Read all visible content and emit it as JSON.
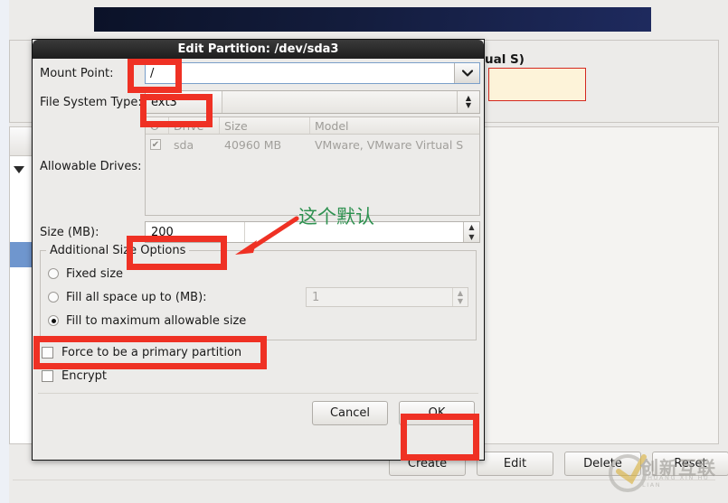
{
  "background": {
    "truncated_label": "ual S)",
    "buttons": [
      "Create",
      "Edit",
      "Delete",
      "Reset"
    ],
    "watermark": {
      "text": "创新互联",
      "subtext": "CHUANG XIN HU LIAN"
    },
    "banner_color": "#131c3c",
    "warn_box_color": "#fdf3d9",
    "warn_border_color": "#d4281f",
    "selection_color": "#6f96ce"
  },
  "dialog": {
    "title": "Edit Partition: /dev/sda3",
    "mount_point": {
      "label": "Mount Point:",
      "value": "/",
      "arrow_icon": "chevron-down-icon"
    },
    "file_system_type": {
      "label": "File System Type:",
      "value": "ext3",
      "spinner_icon": "up-down-spinner-icon"
    },
    "allowable_drives": {
      "label": "Allowable Drives:",
      "columns": [
        "O",
        "Drive",
        "Size",
        "Model"
      ],
      "rows": [
        {
          "checked": "✔",
          "drive": "sda",
          "size": "40960 MB",
          "model": "VMware, VMware Virtual S"
        }
      ]
    },
    "size": {
      "label": "Size (MB):",
      "value": "200"
    },
    "additional_size_options": {
      "legend": "Additional Size Options",
      "options": [
        {
          "label": "Fixed size",
          "selected": false
        },
        {
          "label": "Fill all space up to (MB):",
          "selected": false,
          "value": "1"
        },
        {
          "label": "Fill to maximum allowable size",
          "selected": true
        }
      ]
    },
    "checkboxes": [
      {
        "label": "Force to be a primary partition",
        "checked": false
      },
      {
        "label": "Encrypt",
        "checked": false
      }
    ],
    "buttons": {
      "cancel": "Cancel",
      "ok": "OK"
    }
  },
  "annotations": {
    "note_text": "这个默认",
    "highlight_color": "#ef3124",
    "note_color": "#2e9150",
    "boxes": [
      "mount-point-value",
      "file-system-type-value",
      "size-value",
      "fill-to-maximum-option",
      "ok-button"
    ]
  }
}
